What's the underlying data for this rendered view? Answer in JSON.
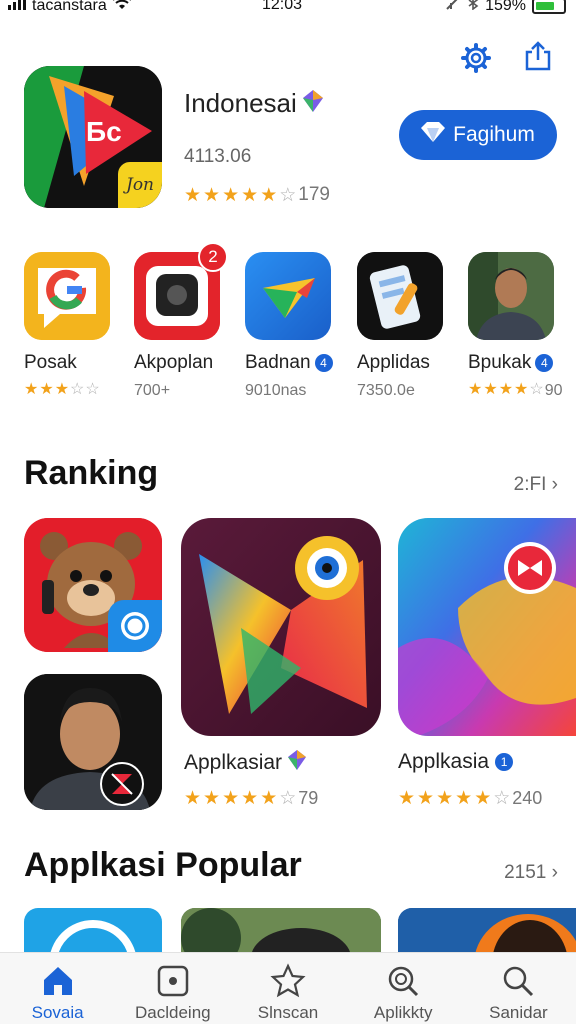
{
  "status_bar": {
    "carrier": "tacanstara",
    "time": "12:03",
    "battery": "159%"
  },
  "header": {
    "settings_icon": "gear-icon",
    "share_icon": "share-icon"
  },
  "featured": {
    "name": "Indonesai",
    "icon_text": "Бс",
    "badge_text": "Jon",
    "subtitle": "4113.06",
    "rating": 4,
    "rating_count": "179",
    "button_label": "Fagihum"
  },
  "apps_row": [
    {
      "name": "Posak",
      "rating": 3,
      "meta": ""
    },
    {
      "name": "Akpoplan",
      "badge": "2",
      "meta": "700+"
    },
    {
      "name": "Badnan",
      "verified": true,
      "meta": "9010nas"
    },
    {
      "name": "Applidas",
      "meta": "7350.0e"
    },
    {
      "name": "Bpukak",
      "verified": true,
      "rating": 3,
      "meta": "90"
    }
  ],
  "ranking": {
    "title": "Ranking",
    "more": "2:FI",
    "apps": [
      {
        "name": "Applkasiar",
        "rating": 4,
        "rating_count": "79"
      },
      {
        "name": "Applkasia",
        "rating": 4,
        "rating_count": "240"
      }
    ]
  },
  "popular": {
    "title": "Applkasi Popular",
    "more": "2151"
  },
  "tabs": [
    {
      "label": "Sovaia",
      "icon": "home-icon",
      "active": true
    },
    {
      "label": "Dacldeing",
      "icon": "square-dot-icon",
      "active": false
    },
    {
      "label": "Slnscan",
      "icon": "star-icon",
      "active": false
    },
    {
      "label": "Aplikkty",
      "icon": "search-icon",
      "active": false
    },
    {
      "label": "Sanidar",
      "icon": "search-icon",
      "active": false
    }
  ],
  "colors": {
    "accent": "#1b63d6",
    "star": "#f2a21b"
  }
}
